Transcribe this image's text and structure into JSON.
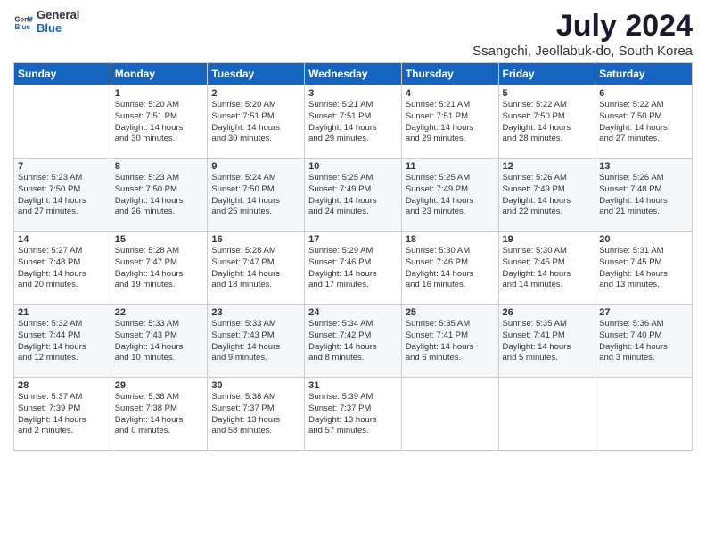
{
  "logo": {
    "general": "General",
    "blue": "Blue"
  },
  "title": "July 2024",
  "subtitle": "Ssangchi, Jeollabuk-do, South Korea",
  "days_header": [
    "Sunday",
    "Monday",
    "Tuesday",
    "Wednesday",
    "Thursday",
    "Friday",
    "Saturday"
  ],
  "weeks": [
    [
      {
        "num": "",
        "info": ""
      },
      {
        "num": "1",
        "info": "Sunrise: 5:20 AM\nSunset: 7:51 PM\nDaylight: 14 hours\nand 30 minutes."
      },
      {
        "num": "2",
        "info": "Sunrise: 5:20 AM\nSunset: 7:51 PM\nDaylight: 14 hours\nand 30 minutes."
      },
      {
        "num": "3",
        "info": "Sunrise: 5:21 AM\nSunset: 7:51 PM\nDaylight: 14 hours\nand 29 minutes."
      },
      {
        "num": "4",
        "info": "Sunrise: 5:21 AM\nSunset: 7:51 PM\nDaylight: 14 hours\nand 29 minutes."
      },
      {
        "num": "5",
        "info": "Sunrise: 5:22 AM\nSunset: 7:50 PM\nDaylight: 14 hours\nand 28 minutes."
      },
      {
        "num": "6",
        "info": "Sunrise: 5:22 AM\nSunset: 7:50 PM\nDaylight: 14 hours\nand 27 minutes."
      }
    ],
    [
      {
        "num": "7",
        "info": "Sunrise: 5:23 AM\nSunset: 7:50 PM\nDaylight: 14 hours\nand 27 minutes."
      },
      {
        "num": "8",
        "info": "Sunrise: 5:23 AM\nSunset: 7:50 PM\nDaylight: 14 hours\nand 26 minutes."
      },
      {
        "num": "9",
        "info": "Sunrise: 5:24 AM\nSunset: 7:50 PM\nDaylight: 14 hours\nand 25 minutes."
      },
      {
        "num": "10",
        "info": "Sunrise: 5:25 AM\nSunset: 7:49 PM\nDaylight: 14 hours\nand 24 minutes."
      },
      {
        "num": "11",
        "info": "Sunrise: 5:25 AM\nSunset: 7:49 PM\nDaylight: 14 hours\nand 23 minutes."
      },
      {
        "num": "12",
        "info": "Sunrise: 5:26 AM\nSunset: 7:49 PM\nDaylight: 14 hours\nand 22 minutes."
      },
      {
        "num": "13",
        "info": "Sunrise: 5:26 AM\nSunset: 7:48 PM\nDaylight: 14 hours\nand 21 minutes."
      }
    ],
    [
      {
        "num": "14",
        "info": "Sunrise: 5:27 AM\nSunset: 7:48 PM\nDaylight: 14 hours\nand 20 minutes."
      },
      {
        "num": "15",
        "info": "Sunrise: 5:28 AM\nSunset: 7:47 PM\nDaylight: 14 hours\nand 19 minutes."
      },
      {
        "num": "16",
        "info": "Sunrise: 5:28 AM\nSunset: 7:47 PM\nDaylight: 14 hours\nand 18 minutes."
      },
      {
        "num": "17",
        "info": "Sunrise: 5:29 AM\nSunset: 7:46 PM\nDaylight: 14 hours\nand 17 minutes."
      },
      {
        "num": "18",
        "info": "Sunrise: 5:30 AM\nSunset: 7:46 PM\nDaylight: 14 hours\nand 16 minutes."
      },
      {
        "num": "19",
        "info": "Sunrise: 5:30 AM\nSunset: 7:45 PM\nDaylight: 14 hours\nand 14 minutes."
      },
      {
        "num": "20",
        "info": "Sunrise: 5:31 AM\nSunset: 7:45 PM\nDaylight: 14 hours\nand 13 minutes."
      }
    ],
    [
      {
        "num": "21",
        "info": "Sunrise: 5:32 AM\nSunset: 7:44 PM\nDaylight: 14 hours\nand 12 minutes."
      },
      {
        "num": "22",
        "info": "Sunrise: 5:33 AM\nSunset: 7:43 PM\nDaylight: 14 hours\nand 10 minutes."
      },
      {
        "num": "23",
        "info": "Sunrise: 5:33 AM\nSunset: 7:43 PM\nDaylight: 14 hours\nand 9 minutes."
      },
      {
        "num": "24",
        "info": "Sunrise: 5:34 AM\nSunset: 7:42 PM\nDaylight: 14 hours\nand 8 minutes."
      },
      {
        "num": "25",
        "info": "Sunrise: 5:35 AM\nSunset: 7:41 PM\nDaylight: 14 hours\nand 6 minutes."
      },
      {
        "num": "26",
        "info": "Sunrise: 5:35 AM\nSunset: 7:41 PM\nDaylight: 14 hours\nand 5 minutes."
      },
      {
        "num": "27",
        "info": "Sunrise: 5:36 AM\nSunset: 7:40 PM\nDaylight: 14 hours\nand 3 minutes."
      }
    ],
    [
      {
        "num": "28",
        "info": "Sunrise: 5:37 AM\nSunset: 7:39 PM\nDaylight: 14 hours\nand 2 minutes."
      },
      {
        "num": "29",
        "info": "Sunrise: 5:38 AM\nSunset: 7:38 PM\nDaylight: 14 hours\nand 0 minutes."
      },
      {
        "num": "30",
        "info": "Sunrise: 5:38 AM\nSunset: 7:37 PM\nDaylight: 13 hours\nand 58 minutes."
      },
      {
        "num": "31",
        "info": "Sunrise: 5:39 AM\nSunset: 7:37 PM\nDaylight: 13 hours\nand 57 minutes."
      },
      {
        "num": "",
        "info": ""
      },
      {
        "num": "",
        "info": ""
      },
      {
        "num": "",
        "info": ""
      }
    ]
  ]
}
